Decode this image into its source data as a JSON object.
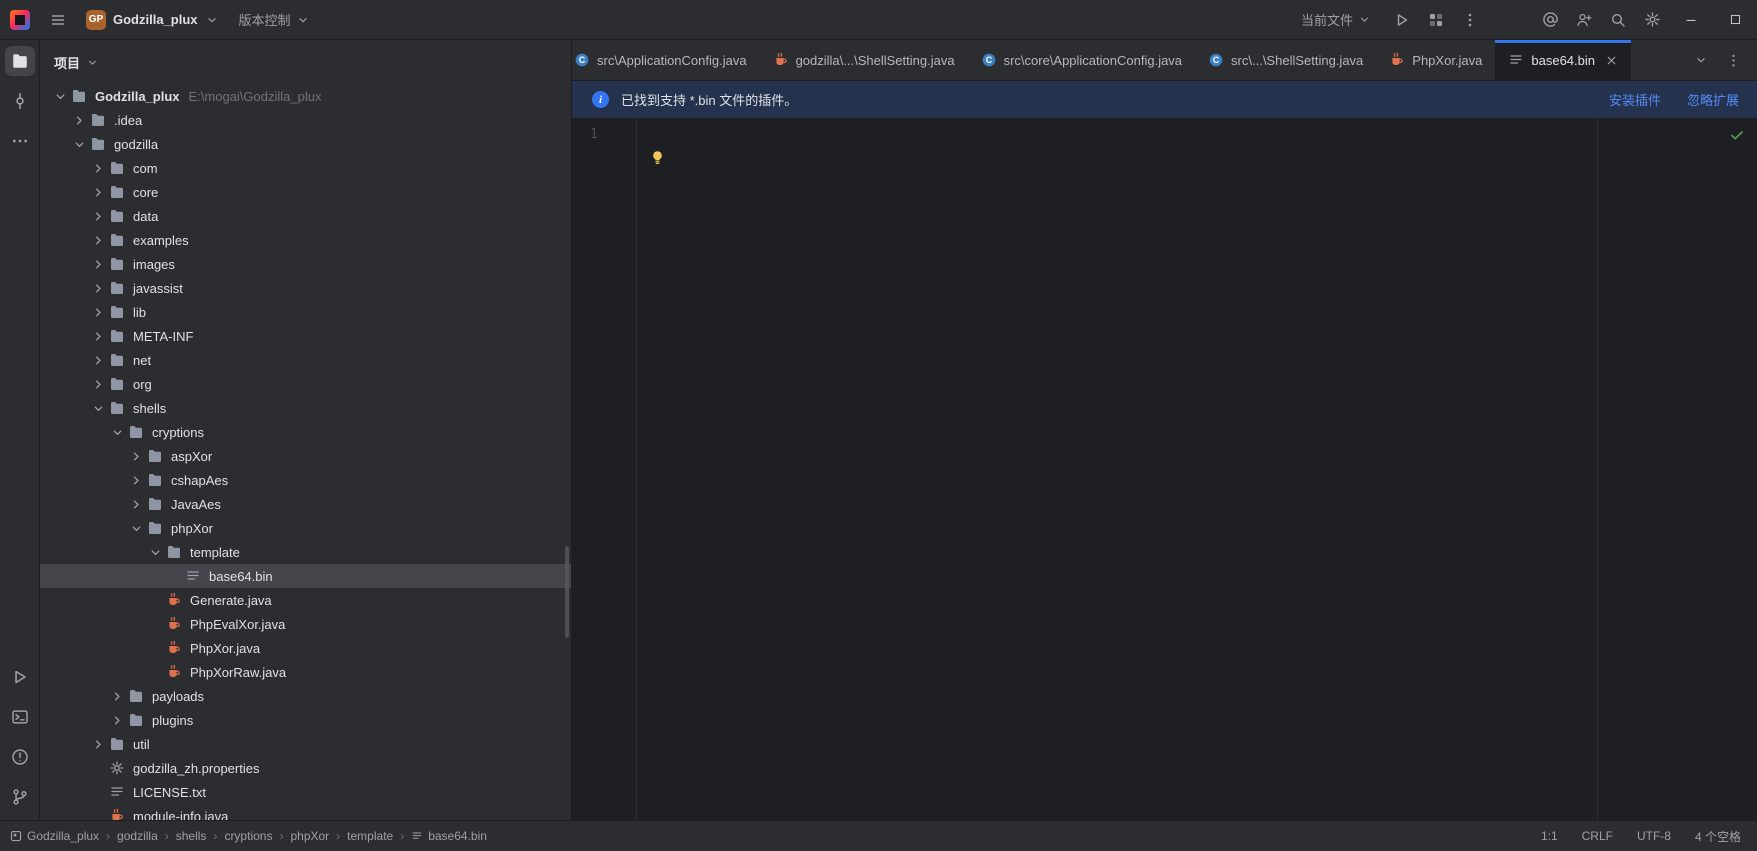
{
  "titlebar": {
    "project_badge": "GP",
    "project_name": "Godzilla_plux",
    "vcs_label": "版本控制",
    "current_file_label": "当前文件"
  },
  "project_panel": {
    "header": "项目",
    "tree": [
      {
        "label": "Godzilla_plux",
        "hint": "E:\\mogai\\Godzilla_plux",
        "indent": 0,
        "chevron": "down",
        "icon": "folder",
        "bold": true
      },
      {
        "label": ".idea",
        "indent": 1,
        "chevron": "right",
        "icon": "folder"
      },
      {
        "label": "godzilla",
        "indent": 1,
        "chevron": "down",
        "icon": "folder"
      },
      {
        "label": "com",
        "indent": 2,
        "chevron": "right",
        "icon": "folder"
      },
      {
        "label": "core",
        "indent": 2,
        "chevron": "right",
        "icon": "folder"
      },
      {
        "label": "data",
        "indent": 2,
        "chevron": "right",
        "icon": "folder"
      },
      {
        "label": "examples",
        "indent": 2,
        "chevron": "right",
        "icon": "folder"
      },
      {
        "label": "images",
        "indent": 2,
        "chevron": "right",
        "icon": "folder"
      },
      {
        "label": "javassist",
        "indent": 2,
        "chevron": "right",
        "icon": "folder"
      },
      {
        "label": "lib",
        "indent": 2,
        "chevron": "right",
        "icon": "folder"
      },
      {
        "label": "META-INF",
        "indent": 2,
        "chevron": "right",
        "icon": "folder"
      },
      {
        "label": "net",
        "indent": 2,
        "chevron": "right",
        "icon": "folder"
      },
      {
        "label": "org",
        "indent": 2,
        "chevron": "right",
        "icon": "folder"
      },
      {
        "label": "shells",
        "indent": 2,
        "chevron": "down",
        "icon": "folder"
      },
      {
        "label": "cryptions",
        "indent": 3,
        "chevron": "down",
        "icon": "folder"
      },
      {
        "label": "aspXor",
        "indent": 4,
        "chevron": "right",
        "icon": "folder"
      },
      {
        "label": "cshapAes",
        "indent": 4,
        "chevron": "right",
        "icon": "folder"
      },
      {
        "label": "JavaAes",
        "indent": 4,
        "chevron": "right",
        "icon": "folder"
      },
      {
        "label": "phpXor",
        "indent": 4,
        "chevron": "down",
        "icon": "folder"
      },
      {
        "label": "template",
        "indent": 5,
        "chevron": "down",
        "icon": "folder"
      },
      {
        "label": "base64.bin",
        "indent": 6,
        "chevron": "none",
        "icon": "text",
        "selected": true
      },
      {
        "label": "Generate.java",
        "indent": 5,
        "chevron": "none",
        "icon": "java"
      },
      {
        "label": "PhpEvalXor.java",
        "indent": 5,
        "chevron": "none",
        "icon": "java"
      },
      {
        "label": "PhpXor.java",
        "indent": 5,
        "chevron": "none",
        "icon": "java"
      },
      {
        "label": "PhpXorRaw.java",
        "indent": 5,
        "chevron": "none",
        "icon": "java"
      },
      {
        "label": "payloads",
        "indent": 3,
        "chevron": "right",
        "icon": "folder"
      },
      {
        "label": "plugins",
        "indent": 3,
        "chevron": "right",
        "icon": "folder"
      },
      {
        "label": "util",
        "indent": 2,
        "chevron": "right",
        "icon": "folder"
      },
      {
        "label": "godzilla_zh.properties",
        "indent": 2,
        "chevron": "none",
        "icon": "properties"
      },
      {
        "label": "LICENSE.txt",
        "indent": 2,
        "chevron": "none",
        "icon": "text"
      },
      {
        "label": "module-info.java",
        "indent": 2,
        "chevron": "none",
        "icon": "java"
      }
    ]
  },
  "tabs": [
    {
      "label": "src\\ApplicationConfig.java",
      "icon": "class",
      "clipped": true
    },
    {
      "label": "godzilla\\...\\ShellSetting.java",
      "icon": "java"
    },
    {
      "label": "src\\core\\ApplicationConfig.java",
      "icon": "class"
    },
    {
      "label": "src\\...\\ShellSetting.java",
      "icon": "class"
    },
    {
      "label": "PhpXor.java",
      "icon": "java"
    },
    {
      "label": "base64.bin",
      "icon": "text",
      "active": true,
      "close": true
    }
  ],
  "banner": {
    "text": "已找到支持 *.bin 文件的插件。",
    "install_label": "安装插件",
    "ignore_label": "忽略扩展"
  },
  "editor": {
    "line_number": "1"
  },
  "statusbar": {
    "breadcrumbs": [
      "Godzilla_plux",
      "godzilla",
      "shells",
      "cryptions",
      "phpXor",
      "template",
      "base64.bin"
    ],
    "caret": "1:1",
    "line_separator": "CRLF",
    "encoding": "UTF-8",
    "indent": "4 个空格"
  },
  "colors": {
    "accent": "#3574f0",
    "link": "#548af7",
    "banner_bg": "#25324d",
    "selection": "#43454a",
    "java_icon": "#e0714d",
    "editor_bg": "#1e1f22",
    "panel_bg": "#2b2d30"
  }
}
